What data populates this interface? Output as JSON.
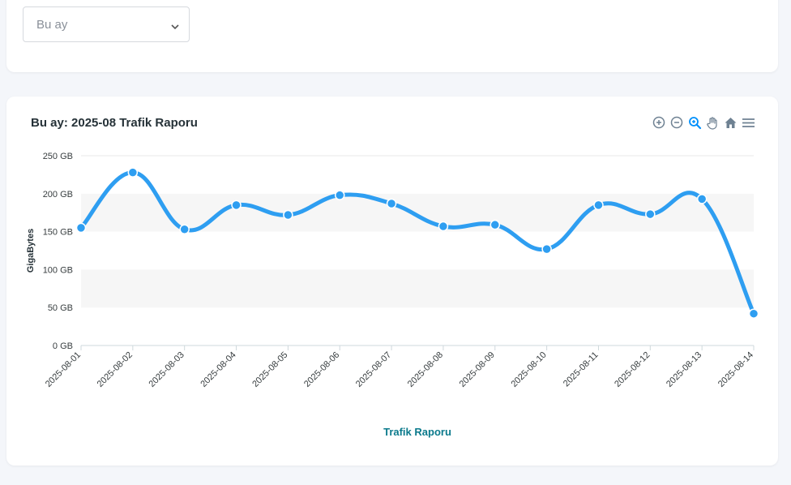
{
  "filter": {
    "selected": "Bu ay"
  },
  "toolbar": {
    "icons": [
      "zoom-in-icon",
      "zoom-out-icon",
      "selection-zoom-icon",
      "pan-hand-icon",
      "home-icon",
      "menu-icon"
    ],
    "active_color": "#008ffb",
    "inactive_color": "#6e8192"
  },
  "chart_data": {
    "type": "line",
    "title": "Bu ay: 2025-08 Trafik Raporu",
    "xlabel": "Trafik Raporu",
    "ylabel": "GigaBytes",
    "ylim": [
      0,
      250
    ],
    "y_ticks": [
      "0 GB",
      "50 GB",
      "100 GB",
      "150 GB",
      "200 GB",
      "250 GB"
    ],
    "y_tick_values": [
      0,
      50,
      100,
      150,
      200,
      250
    ],
    "grid": "banded",
    "categories": [
      "2025-08-01",
      "2025-08-02",
      "2025-08-03",
      "2025-08-04",
      "2025-08-05",
      "2025-08-06",
      "2025-08-07",
      "2025-08-08",
      "2025-08-09",
      "2025-08-10",
      "2025-08-11",
      "2025-08-12",
      "2025-08-13",
      "2025-08-14"
    ],
    "series": [
      {
        "values": [
          155,
          228,
          153,
          185,
          172,
          198,
          187,
          157,
          159,
          127,
          185,
          173,
          193,
          42
        ],
        "color": "#2e9ef1"
      }
    ],
    "xlabel_color": "#0b7a8c"
  }
}
